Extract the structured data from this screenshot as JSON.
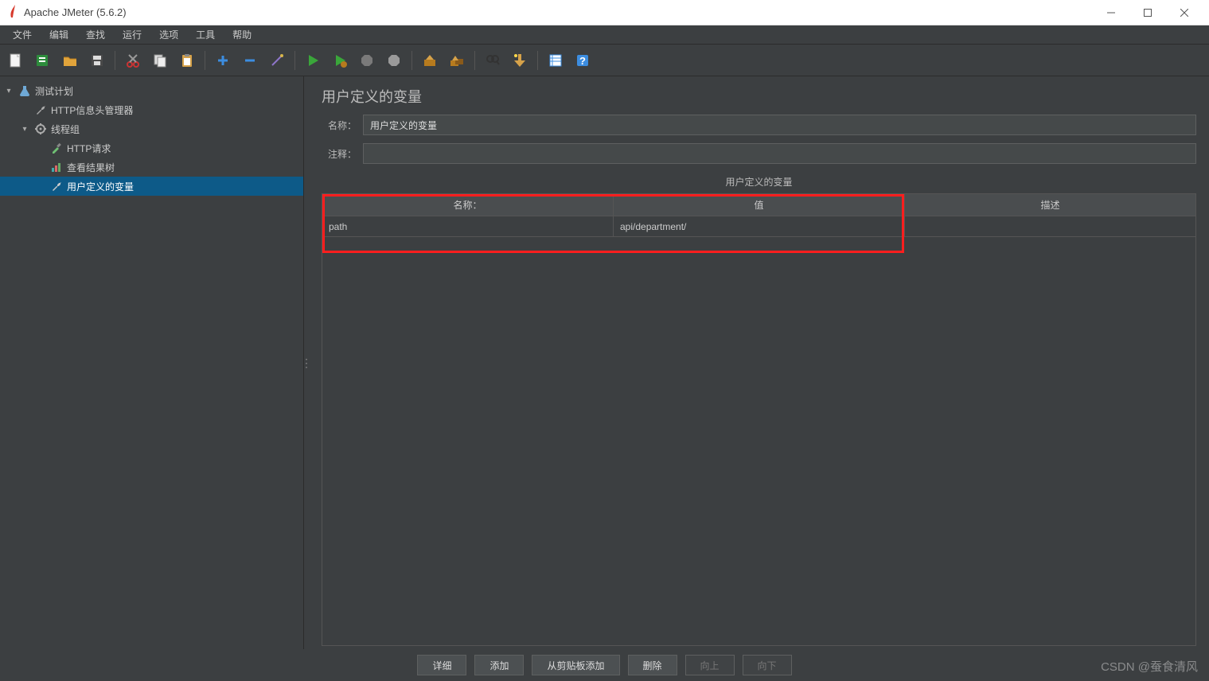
{
  "window": {
    "title": "Apache JMeter (5.6.2)"
  },
  "menubar": [
    "文件",
    "编辑",
    "查找",
    "运行",
    "选项",
    "工具",
    "帮助"
  ],
  "toolbar_icons": [
    "new-file-icon",
    "open-template-icon",
    "open-folder-icon",
    "save-icon",
    "cut-icon",
    "copy-icon",
    "paste-icon",
    "add-icon",
    "remove-icon",
    "wand-icon",
    "play-icon",
    "play-no-timer-icon",
    "stop-icon",
    "shutdown-icon",
    "clear-one-icon",
    "clear-all-icon",
    "find-icon",
    "function-icon",
    "toggle-icon",
    "help-icon"
  ],
  "tree": {
    "items": [
      {
        "label": "测试计划",
        "icon": "flask-icon",
        "depth": 0,
        "expanded": true
      },
      {
        "label": "HTTP信息头管理器",
        "icon": "wrench-icon",
        "depth": 1
      },
      {
        "label": "线程组",
        "icon": "gear-icon",
        "depth": 1,
        "expanded": true
      },
      {
        "label": "HTTP请求",
        "icon": "dropper-icon",
        "depth": 2
      },
      {
        "label": "查看结果树",
        "icon": "chart-icon",
        "depth": 2
      },
      {
        "label": "用户定义的变量",
        "icon": "wrench-icon",
        "depth": 2,
        "selected": true
      }
    ]
  },
  "panel": {
    "title": "用户定义的变量",
    "name_label": "名称：",
    "name_value": "用户定义的变量",
    "comment_label": "注释：",
    "comment_value": "",
    "section_label": "用户定义的变量",
    "table": {
      "headers": [
        "名称：",
        "值",
        "描述"
      ],
      "rows": [
        {
          "name": "path",
          "value": "api/department/",
          "desc": ""
        }
      ]
    },
    "buttons": {
      "detail": "详细",
      "add": "添加",
      "add_clipboard": "从剪贴板添加",
      "delete": "删除",
      "up": "向上",
      "down": "向下"
    }
  },
  "watermark": "CSDN @蚕食清风"
}
